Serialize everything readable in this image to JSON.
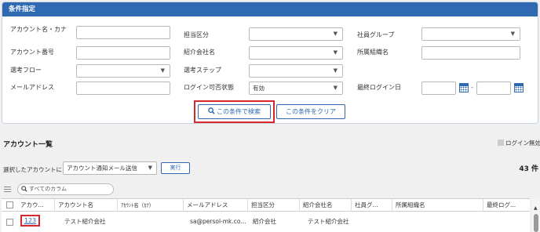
{
  "panel": {
    "title": "条件指定"
  },
  "fields": {
    "account_name": {
      "label": "アカウント名・カナ",
      "value": ""
    },
    "account_number": {
      "label": "アカウント番号",
      "value": ""
    },
    "selection_flow": {
      "label": "選考フロー",
      "value": ""
    },
    "email": {
      "label": "メールアドレス",
      "value": ""
    },
    "division": {
      "label": "担当区分",
      "value": ""
    },
    "referral_company": {
      "label": "紹介会社名",
      "value": ""
    },
    "selection_step": {
      "label": "選考ステップ",
      "value": ""
    },
    "login_status": {
      "label": "ログイン可否状態",
      "value": "有効"
    },
    "employee_group": {
      "label": "社員グループ",
      "value": ""
    },
    "department": {
      "label": "所属組織名",
      "value": ""
    },
    "last_login": {
      "label": "最終ログイン日",
      "from": "",
      "to": "",
      "separator": "-"
    }
  },
  "buttons": {
    "search": "この条件で検索",
    "clear": "この条件をクリア"
  },
  "list": {
    "title": "アカウント一覧",
    "legend": "ログイン無効",
    "bulk_label": "選択したアカウントに",
    "bulk_action": "アカウント通知メール送信",
    "execute": "実行",
    "count": "43 件",
    "column_search_placeholder": "すべてのカラム"
  },
  "table": {
    "columns": [
      "アカウ...",
      "アカウント名",
      "ｱｶｳﾝﾄ名（ｶﾅ）",
      "メールアドレス",
      "担当区分",
      "紹介会社名",
      "社員グ...",
      "所属組織名",
      "最終ログ..."
    ],
    "rows": [
      {
        "id": "123",
        "name": "テスト紹介会社",
        "kana": "",
        "email": "sa@persol-mk.co...",
        "division": "紹介会社",
        "company": "テスト紹介会社",
        "group": "",
        "department": "",
        "last_login": ""
      }
    ]
  },
  "icons": [
    "search-icon",
    "calendar-icon",
    "chevron-down-icon",
    "menu-icon",
    "checkbox-icon"
  ],
  "colors": {
    "header": "#2e69b2",
    "accent": "#2e69b2",
    "highlight": "#d7262c"
  }
}
